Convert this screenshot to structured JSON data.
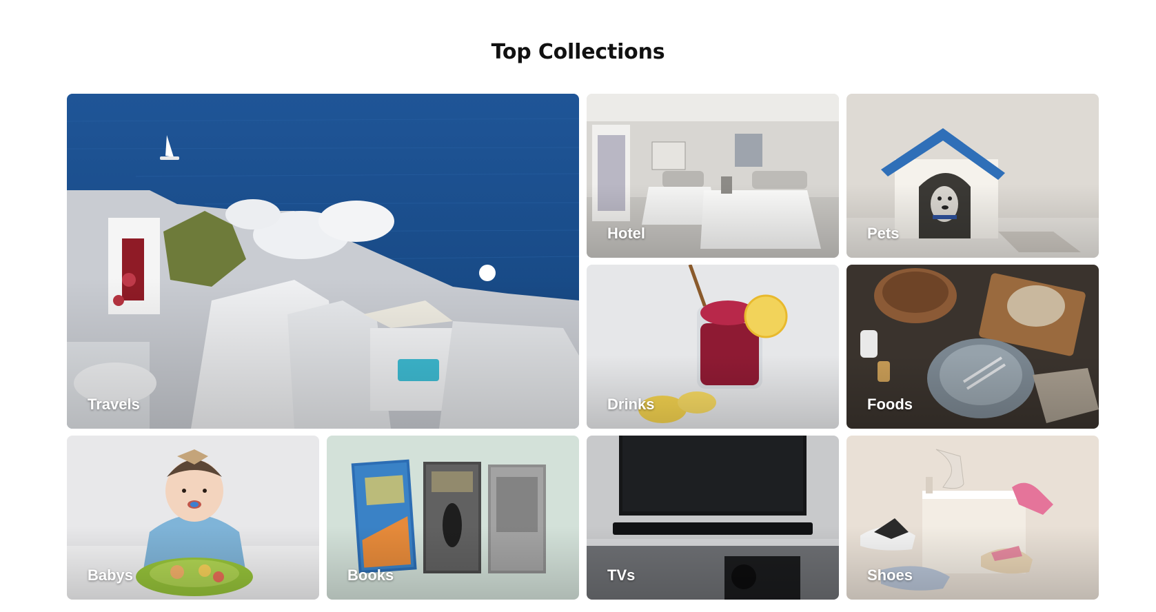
{
  "section": {
    "title": "Top Collections"
  },
  "collections": [
    {
      "label": "Travels",
      "icon": "santorini-coast-photo"
    },
    {
      "label": "Hotel",
      "icon": "hotel-bedroom-photo"
    },
    {
      "label": "Pets",
      "icon": "dog-house-photo"
    },
    {
      "label": "Drinks",
      "icon": "berry-drink-photo"
    },
    {
      "label": "Foods",
      "icon": "table-setting-photo"
    },
    {
      "label": "Babys",
      "icon": "baby-eating-photo"
    },
    {
      "label": "Books",
      "icon": "books-photo"
    },
    {
      "label": "TVs",
      "icon": "television-photo"
    },
    {
      "label": "Shoes",
      "icon": "shoes-photo"
    }
  ],
  "colors": {
    "title": "#111111",
    "label": "#ffffff",
    "sea": "#1c4f8e",
    "background": "#ffffff"
  }
}
